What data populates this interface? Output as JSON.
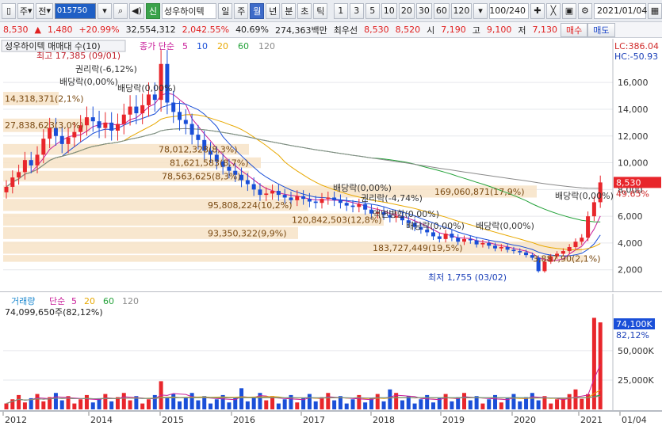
{
  "toolbar": {
    "market_type": "주",
    "menu_label": "전",
    "stock_code": "015750",
    "stock_name_badge": "신",
    "stock_name": "성우하이텍",
    "periods": [
      "일",
      "주",
      "월",
      "년",
      "분",
      "초",
      "틱"
    ],
    "selected_period": "월",
    "intervals": [
      "1",
      "3",
      "5",
      "10",
      "20",
      "30",
      "60",
      "120"
    ],
    "count_value": "100/240",
    "date_value": "2021/01/04"
  },
  "quote": {
    "price": "8,530",
    "change": "1,480",
    "change_pct": "+20.99%",
    "volume": "32,554,312",
    "volume_pct": "2,042.55%",
    "turnover_pct": "40.69%",
    "amount": "274,363백만",
    "best_label": "최우선",
    "ask": "8,530",
    "bid": "8,520",
    "open_label": "시",
    "open": "7,190",
    "high_label": "고",
    "high": "9,100",
    "low_label": "저",
    "low": "7,130",
    "sell_label": "매수",
    "buy_label": "매도"
  },
  "price_pane": {
    "title": "성우하이텍 매매대 수(10)",
    "ma_label": "종가 단순",
    "ma_periods": [
      "5",
      "10",
      "20",
      "60",
      "120"
    ],
    "ma_colors": [
      "#c91f9a",
      "#1a4fd8",
      "#e8a800",
      "#24a23a",
      "#8a8a8a"
    ],
    "lc": "LC:386.04",
    "hc": "HC:-50.93",
    "y_ticks": [
      "16,000",
      "14,000",
      "12,000",
      "10,000",
      "8,000",
      "6,000",
      "4,000",
      "2,000"
    ],
    "current_price": "8,530",
    "current_pct": "49.65%",
    "high_note": "최고 17,385 (09/01)",
    "low_note": "최저 1,755 (03/02)",
    "volume_profile": [
      {
        "label": "14,318,371(2,1%)"
      },
      {
        "label": "27,838,623(3,0%)"
      },
      {
        "label": "78,012,328(8,3%)"
      },
      {
        "label": "81,621,583(8,7%)"
      },
      {
        "label": "78,563,625(8,3%)"
      },
      {
        "label": "169,060,871(17,9%)"
      },
      {
        "label": "95,808,224(10,2%)"
      },
      {
        "label": "120,842,503(12,8%)"
      },
      {
        "label": "93,350,322(9,9%)"
      },
      {
        "label": "183,727,449(19,5%)"
      },
      {
        "label": "3,887,90(2,1%)"
      }
    ],
    "annotations": [
      "권리락(-6,12%)",
      "배당락(0,00%)",
      "배당락(0,00%)",
      "권리락(-4,74%)",
      "액면병합(0,00%)",
      "배당락(0,00%)",
      "배당락(0,00%)",
      "배당락(0,00%)"
    ]
  },
  "volume_pane": {
    "title": "거래량",
    "ma_label": "단순",
    "ma_periods": [
      "5",
      "20",
      "60",
      "120"
    ],
    "value_note": "74,099,650주(82,12%)",
    "current": "74,100K",
    "current_pct": "82,12%",
    "y_ticks": [
      "50,000K",
      "25,000K"
    ]
  },
  "x_axis": {
    "labels": [
      "2012",
      "2014",
      "2015",
      "2016",
      "2017",
      "2018",
      "2019",
      "2020",
      "2021",
      "01/04"
    ]
  },
  "chart_data": {
    "type": "candlestick",
    "title": "성우하이텍",
    "ylim": [
      800,
      18200
    ],
    "series_close": [
      8200,
      8900,
      9300,
      10200,
      9800,
      10600,
      11800,
      12600,
      12000,
      11400,
      11900,
      12300,
      12800,
      13400,
      13100,
      12600,
      13000,
      12400,
      12900,
      13600,
      14200,
      13700,
      14300,
      15100,
      14700,
      17385,
      14500,
      13800,
      13200,
      12900,
      12100,
      11700,
      10900,
      10600,
      10100,
      9700,
      9400,
      9100,
      8700,
      8400,
      8000,
      7600,
      7700,
      7900,
      7600,
      7400,
      7200,
      7500,
      7300,
      7100,
      7000,
      7300,
      7400,
      7200,
      7000,
      6800,
      6700,
      6900,
      6500,
      6200,
      6300,
      6100,
      5900,
      6000,
      5700,
      5500,
      5200,
      5000,
      4800,
      4500,
      4300,
      4700,
      4400,
      4100,
      4300,
      4200,
      3900,
      4000,
      3800,
      3600,
      3700,
      3500,
      3400,
      3300,
      3100,
      2900,
      1900,
      2600,
      3000,
      3200,
      3400,
      3700,
      4100,
      4400,
      6000,
      7050,
      8530
    ],
    "y_tick_values": [
      16000,
      14000,
      12000,
      10000,
      8000,
      6000,
      4000,
      2000
    ]
  }
}
